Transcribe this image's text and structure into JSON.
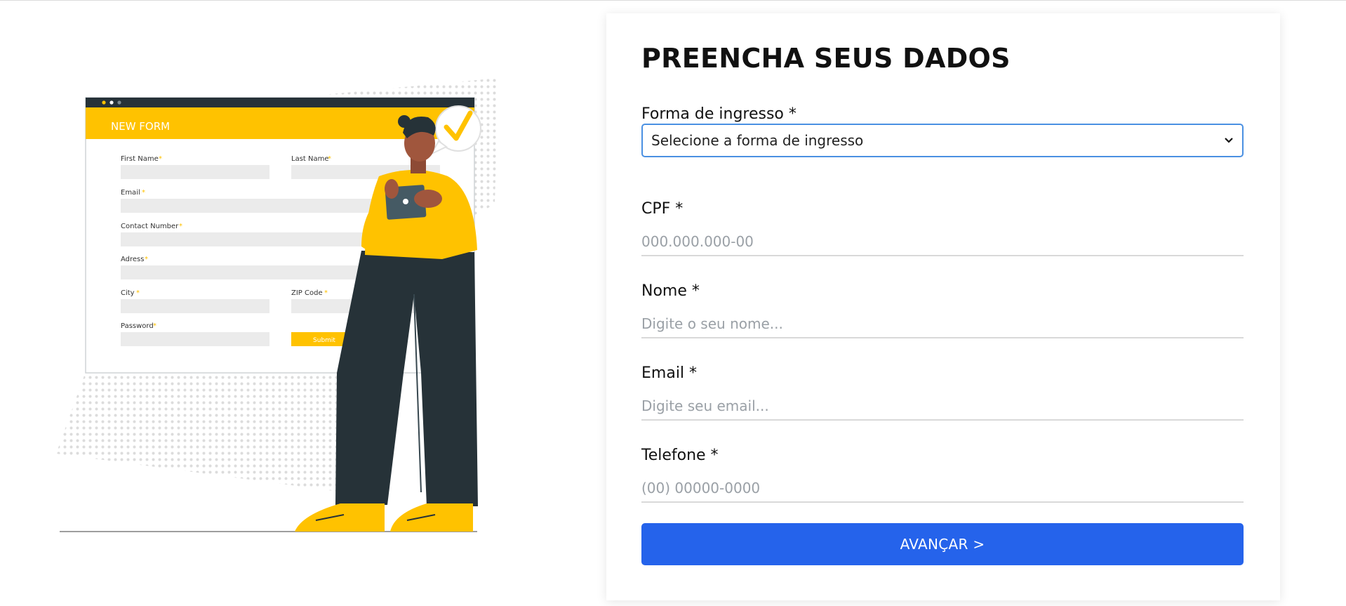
{
  "form": {
    "title": "PREENCHA SEUS DADOS",
    "ingresso": {
      "label": "Forma de ingresso *",
      "selected": "Selecione a forma de ingresso"
    },
    "cpf": {
      "label": "CPF *",
      "placeholder": "000.000.000-00"
    },
    "nome": {
      "label": "Nome *",
      "placeholder": "Digite o seu nome..."
    },
    "email": {
      "label": "Email *",
      "placeholder": "Digite seu email..."
    },
    "telefone": {
      "label": "Telefone *",
      "placeholder": "(00) 00000-0000"
    },
    "submit_label": "AVANÇAR >"
  },
  "illustration": {
    "form_header": "NEW FORM",
    "labels": {
      "first_name": "First Name",
      "last_name": "Last Name",
      "email": "Email",
      "contact": "Contact Number",
      "address": "Adress",
      "city": "City",
      "zip": "ZIP Code",
      "password": "Password"
    },
    "required_mark": "*",
    "submit": "Submit"
  },
  "colors": {
    "accent": "#2563eb",
    "illustration_yellow": "#ffc200",
    "illustration_dark": "#263238"
  }
}
